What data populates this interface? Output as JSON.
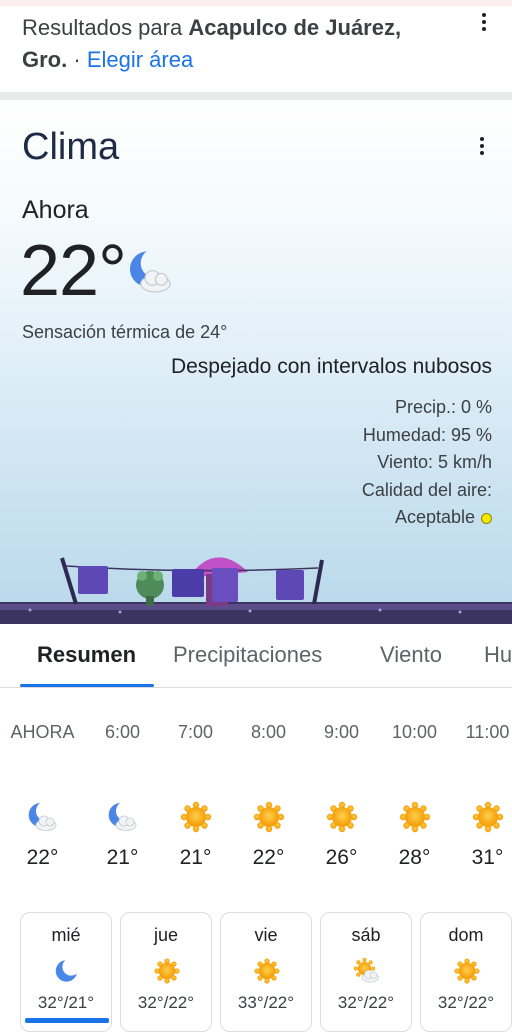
{
  "header": {
    "results_prefix": "Resultados para",
    "location": "Acapulco de Juárez, Gro.",
    "separator": "·",
    "choose_area": "Elegir área"
  },
  "weather": {
    "title": "Clima",
    "now_label": "Ahora",
    "temperature": "22°",
    "current_icon": "moon-cloud-icon",
    "feels_like": "Sensación térmica de 24°",
    "condition": "Despejado con intervalos nubosos",
    "precip": "Precip.: 0 %",
    "humidity": "Humedad: 95 %",
    "wind": "Viento: 5 km/h",
    "air_quality_label": "Calidad del aire:",
    "air_quality_value": "Aceptable",
    "air_quality_color": "#f6e600"
  },
  "tabs": [
    {
      "label": "Resumen"
    },
    {
      "label": "Precipitaciones"
    },
    {
      "label": "Viento"
    },
    {
      "label": "Hu"
    }
  ],
  "hourly": [
    {
      "time": "AHORA",
      "temp": "22°",
      "icon": "moon-cloud-icon"
    },
    {
      "time": "6:00",
      "temp": "21°",
      "icon": "moon-cloud-icon"
    },
    {
      "time": "7:00",
      "temp": "21°",
      "icon": "sun-icon"
    },
    {
      "time": "8:00",
      "temp": "22°",
      "icon": "sun-icon"
    },
    {
      "time": "9:00",
      "temp": "26°",
      "icon": "sun-icon"
    },
    {
      "time": "10:00",
      "temp": "28°",
      "icon": "sun-icon"
    },
    {
      "time": "11:00",
      "temp": "31°",
      "icon": "sun-icon"
    }
  ],
  "daily": [
    {
      "day": "mié",
      "range": "32°/21°",
      "icon": "moon-icon"
    },
    {
      "day": "jue",
      "range": "32°/22°",
      "icon": "sun-icon"
    },
    {
      "day": "vie",
      "range": "33°/22°",
      "icon": "sun-icon"
    },
    {
      "day": "sáb",
      "range": "32°/22°",
      "icon": "sun-cloud-icon"
    },
    {
      "day": "dom",
      "range": "32°/22°",
      "icon": "sun-icon"
    }
  ],
  "colors": {
    "accent": "#1a73e8",
    "sun": "#f5a623",
    "moon": "#4285f4"
  }
}
